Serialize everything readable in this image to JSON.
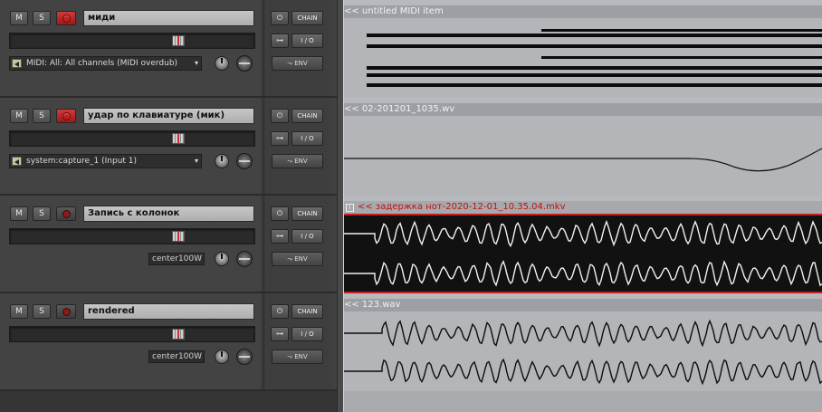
{
  "tracks": [
    {
      "mute": "M",
      "solo": "S",
      "armed": true,
      "name": "миди",
      "input": "MIDI: All: All channels (MIDI overdub)",
      "pan": "",
      "chain": "CHAIN",
      "io": "I / O",
      "env": "ENV"
    },
    {
      "mute": "M",
      "solo": "S",
      "armed": true,
      "name": "удар по клавиатуре (мик)",
      "input": "system:capture_1 (Input 1)",
      "pan": "",
      "chain": "CHAIN",
      "io": "I / O",
      "env": "ENV"
    },
    {
      "mute": "M",
      "solo": "S",
      "armed": false,
      "name": "Запись с колонок",
      "input": "",
      "pan": "center100W",
      "chain": "CHAIN",
      "io": "I / O",
      "env": "ENV"
    },
    {
      "mute": "M",
      "solo": "S",
      "armed": false,
      "name": "rendered",
      "input": "",
      "pan": "center100W",
      "chain": "CHAIN",
      "io": "I / O",
      "env": "ENV"
    }
  ],
  "items": [
    {
      "title": "<< untitled MIDI item",
      "selected": false
    },
    {
      "title": "<< 02-201201_1035.wv",
      "selected": false
    },
    {
      "title": "<< задержка нот-2020-12-01_10.35.04.mkv",
      "selected": true
    },
    {
      "title": "<< 123.wav",
      "selected": false
    }
  ],
  "colors": {
    "rec_armed": "#c02020",
    "selected_item": "#c01010",
    "playhead": "#e8e84a"
  },
  "icons": {
    "power": "power-icon",
    "route": "route-icon",
    "envelope": "envelope-icon",
    "speaker": "midi-input-icon"
  }
}
